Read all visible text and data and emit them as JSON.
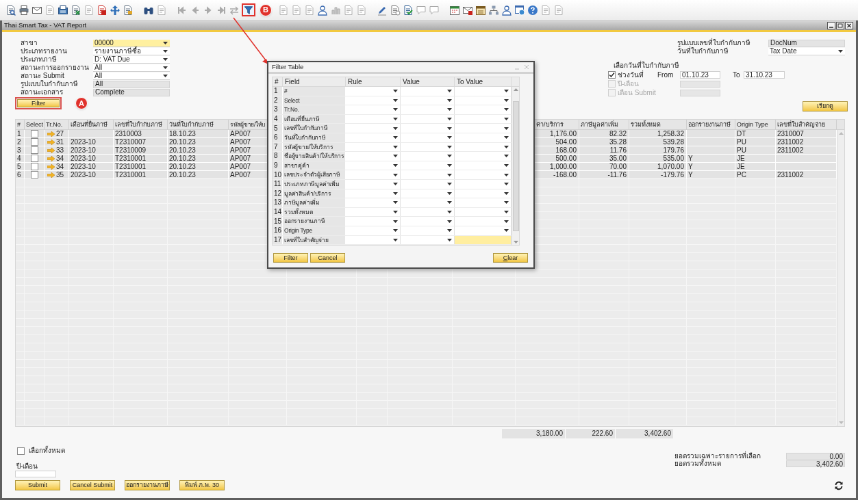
{
  "window": {
    "title": "Thai Smart Tax - VAT Report"
  },
  "annotations": [
    {
      "label": "B"
    },
    {
      "label": "A"
    }
  ],
  "form_left": [
    {
      "label": "สาขา",
      "value": "00000",
      "kind": "dropdown",
      "focused": true
    },
    {
      "label": "ประเภทรายงาน",
      "value": "รายงานภาษีซื้อ",
      "kind": "dropdown",
      "focused": false
    },
    {
      "label": "ประเภทภาษี",
      "value": "D: VAT Due",
      "kind": "dropdown",
      "focused": false
    },
    {
      "label": "สถานะการออกรายงาน",
      "value": "All",
      "kind": "dropdown",
      "focused": false
    },
    {
      "label": "สถานะ Submit",
      "value": "All",
      "kind": "dropdown",
      "focused": false
    },
    {
      "label": "รูปแบบใบกำกับภาษี",
      "value": "All",
      "kind": "readonly",
      "focused": false
    },
    {
      "label": "สถานะเอกสาร",
      "value": "Complete",
      "kind": "readonly",
      "focused": false
    }
  ],
  "filter_button": "Filter",
  "form_right": [
    {
      "label": "รูปแบบเลขที่ใบกำกับภาษี",
      "value": "DocNum",
      "kind": "readonly"
    },
    {
      "label": "วันที่ใบกำกับภาษี",
      "value": "Tax Date",
      "kind": "dropdown"
    }
  ],
  "date_selection": {
    "title": "เลือกวันที่ใบกำกับภาษี",
    "options": [
      {
        "label": "ช่วงวันที่",
        "checked": true,
        "disabled": false,
        "from_label": "From",
        "from": "01.10.23",
        "to_label": "To",
        "to": "31.10.23"
      },
      {
        "label": "ปี-เดือน",
        "checked": false,
        "disabled": true
      },
      {
        "label": "เดือน Submit",
        "checked": false,
        "disabled": true
      }
    ]
  },
  "view_button": "เรียกดู",
  "table": {
    "columns": [
      "#",
      "Select",
      "Tr.No.",
      "เดือนที่ยื่นภาษี",
      "เลขที่ใบกำกับภาษี",
      "วันที่ใบกำกับภาษี",
      "รหัสผู้ขาย/ให้บ",
      "ค่า/บริการ",
      "ภาษีมูลค่าเพิ่ม",
      "รวมทั้งหมด",
      "ออกรายงานภาษี",
      "Origin Type",
      "เลขที่ใบสำคัญจ่าย"
    ],
    "rows": [
      {
        "num": "1",
        "checked": false,
        "tr_no": "27",
        "invoice_no": "2310003",
        "invoice_date": "18.10.23",
        "vendor_code": "AP007",
        "amount": "1,176.00",
        "vat": "82.32",
        "total": "1,258.32",
        "origin_type": "DT",
        "voucher_no": "2310007"
      },
      {
        "num": "2",
        "checked": false,
        "tr_no": "31",
        "month": "2023-10",
        "invoice_no": "T2310007",
        "invoice_date": "20.10.23",
        "vendor_code": "AP007",
        "amount": "504.00",
        "vat": "35.28",
        "total": "539.28",
        "origin_type": "PU",
        "voucher_no": "2311002"
      },
      {
        "num": "3",
        "checked": false,
        "tr_no": "33",
        "month": "2023-10",
        "invoice_no": "T2310009",
        "invoice_date": "20.10.23",
        "vendor_code": "AP007",
        "amount": "168.00",
        "vat": "11.76",
        "total": "179.76",
        "origin_type": "PU",
        "voucher_no": "2311002"
      },
      {
        "num": "4",
        "checked": false,
        "tr_no": "34",
        "month": "2023-10",
        "invoice_no": "T2310001",
        "invoice_date": "20.10.23",
        "vendor_code": "AP007",
        "amount": "500.00",
        "vat": "35.00",
        "total": "535.00",
        "reported": "Y",
        "origin_type": "JE"
      },
      {
        "num": "5",
        "checked": false,
        "tr_no": "34",
        "month": "2023-10",
        "invoice_no": "T2310001",
        "invoice_date": "20.10.23",
        "vendor_code": "AP007",
        "amount": "1,000.00",
        "vat": "70.00",
        "total": "1,070.00",
        "reported": "Y",
        "origin_type": "JE"
      },
      {
        "num": "6",
        "checked": false,
        "tr_no": "35",
        "month": "2023-10",
        "invoice_no": "T2310001",
        "invoice_date": "20.10.23",
        "vendor_code": "AP007",
        "amount": "-168.00",
        "vat": "-11.76",
        "total": "-179.76",
        "reported": "Y",
        "origin_type": "PC",
        "voucher_no": "2311002"
      }
    ],
    "totals": {
      "amount": "3,180.00",
      "vat": "222.60",
      "total": "3,402.60"
    }
  },
  "select_all": {
    "label": "เลือกทั้งหมด",
    "checked": false
  },
  "period": {
    "label": "ปี-เดือน"
  },
  "buttons": [
    "Submit",
    "Cancel Submit",
    "ออกรายงานภาษี",
    "พิมพ์ ภ.พ. 30"
  ],
  "summary": [
    {
      "label": "ยอดรวมเฉพาะรายการที่เลือก",
      "value": "0.00"
    },
    {
      "label": "ยอดรวมทั้งหมด",
      "value": "3,402.60"
    }
  ],
  "filter_dialog": {
    "title": "Filter Table",
    "columns": [
      "#",
      "Field",
      "Rule",
      "Value",
      "To Value"
    ],
    "rows": [
      {
        "num": "1",
        "field": "#",
        "focused": false
      },
      {
        "num": "2",
        "field": "Select",
        "focused": false
      },
      {
        "num": "3",
        "field": "Tr.No.",
        "focused": false
      },
      {
        "num": "4",
        "field": "เดือนที่ยื่นภาษี",
        "focused": false
      },
      {
        "num": "5",
        "field": "เลขที่ใบกำกับภาษี",
        "focused": false
      },
      {
        "num": "6",
        "field": "วันที่ใบกำกับภาษี",
        "focused": false
      },
      {
        "num": "7",
        "field": "รหัสผู้ขาย/ให้บริการ",
        "focused": false
      },
      {
        "num": "8",
        "field": "ชื่อผู้ขายสินค้า/ให้บริการ",
        "focused": false
      },
      {
        "num": "9",
        "field": "สาขาคู่ค้า",
        "focused": false
      },
      {
        "num": "10",
        "field": "เลขประจำตัวผู้เสียภาษี",
        "focused": false
      },
      {
        "num": "11",
        "field": "ประเภทภาษีมูลค่าเพิ่ม",
        "focused": false
      },
      {
        "num": "12",
        "field": "มูลค่าสินค้า/บริการ",
        "focused": false
      },
      {
        "num": "13",
        "field": "ภาษีมูลค่าเพิ่ม",
        "focused": false
      },
      {
        "num": "14",
        "field": "รวมทั้งหมด",
        "focused": false
      },
      {
        "num": "15",
        "field": "ออกรายงานภาษี",
        "focused": false
      },
      {
        "num": "16",
        "field": "Origin Type",
        "focused": false
      },
      {
        "num": "17",
        "field": "เลขที่ใบสำคัญจ่าย",
        "focused": true
      }
    ],
    "buttons": [
      "Filter",
      "Cancel"
    ],
    "clear_button": "Clear"
  }
}
